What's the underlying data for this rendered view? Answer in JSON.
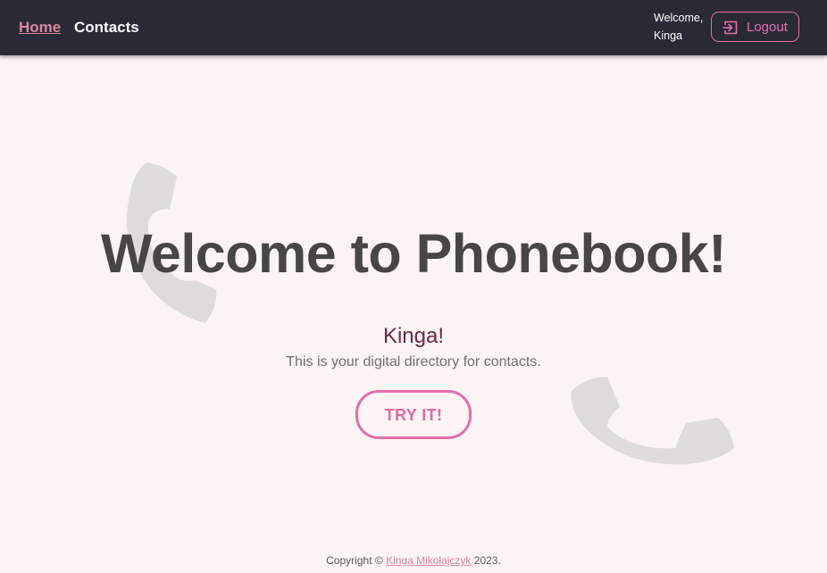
{
  "navbar": {
    "home_label": "Home",
    "contacts_label": "Contacts",
    "welcome_line1": "Welcome,",
    "welcome_line2": "Kinga",
    "logout_label": "Logout",
    "logout_icon": "logout-icon"
  },
  "hero": {
    "title": "Welcome to Phonebook!",
    "greeting": "Kinga!",
    "tagline": "This is your digital directory for contacts.",
    "cta_label": "TRY IT!",
    "background_icon": "phone-icon"
  },
  "footer": {
    "prefix": "Copyright ©",
    "author": "Kinga Mikołajczyk",
    "year": "2023."
  },
  "colors": {
    "navbar_bg": "#2a2936",
    "page_bg": "#fbf3f4",
    "accent_pink": "#e36fa8",
    "link_pink": "#d9879e",
    "title_gray": "#474545",
    "greeting_plum": "#6b2647",
    "phone_gray": "#dedbdc"
  }
}
